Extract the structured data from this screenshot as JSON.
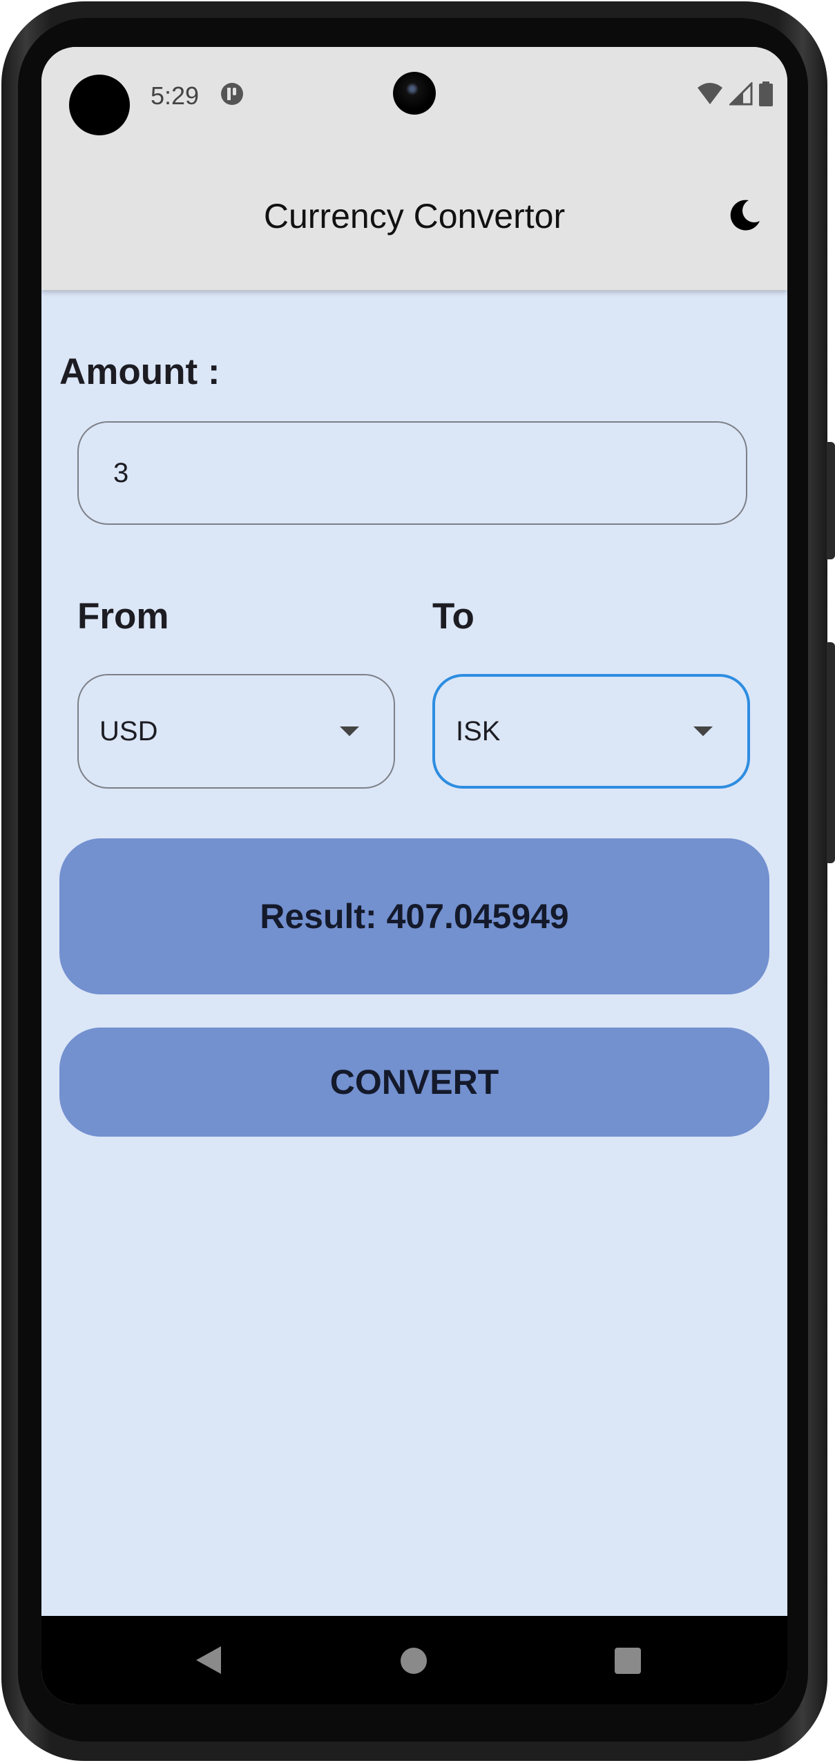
{
  "status_bar": {
    "time": "5:29",
    "icons": [
      "app-notification-icon",
      "wifi-icon",
      "signal-icon",
      "battery-icon"
    ]
  },
  "app_bar": {
    "title": "Currency Convertor",
    "theme_toggle_icon": "moon-icon"
  },
  "form": {
    "amount_label": "Amount :",
    "amount_value": "3",
    "from_label": "From",
    "to_label": "To",
    "from_currency": "USD",
    "to_currency": "ISK"
  },
  "result": {
    "text": "Result: 407.045949"
  },
  "actions": {
    "convert_label": "CONVERT"
  },
  "nav_bar": {
    "icons": [
      "back-icon",
      "home-icon",
      "recents-icon"
    ]
  },
  "colors": {
    "background": "#dbe6f7",
    "app_bar": "#e4e3e3",
    "accent_button": "#7390cf",
    "focus_border": "#2d8de0",
    "text": "#1c1c22"
  }
}
